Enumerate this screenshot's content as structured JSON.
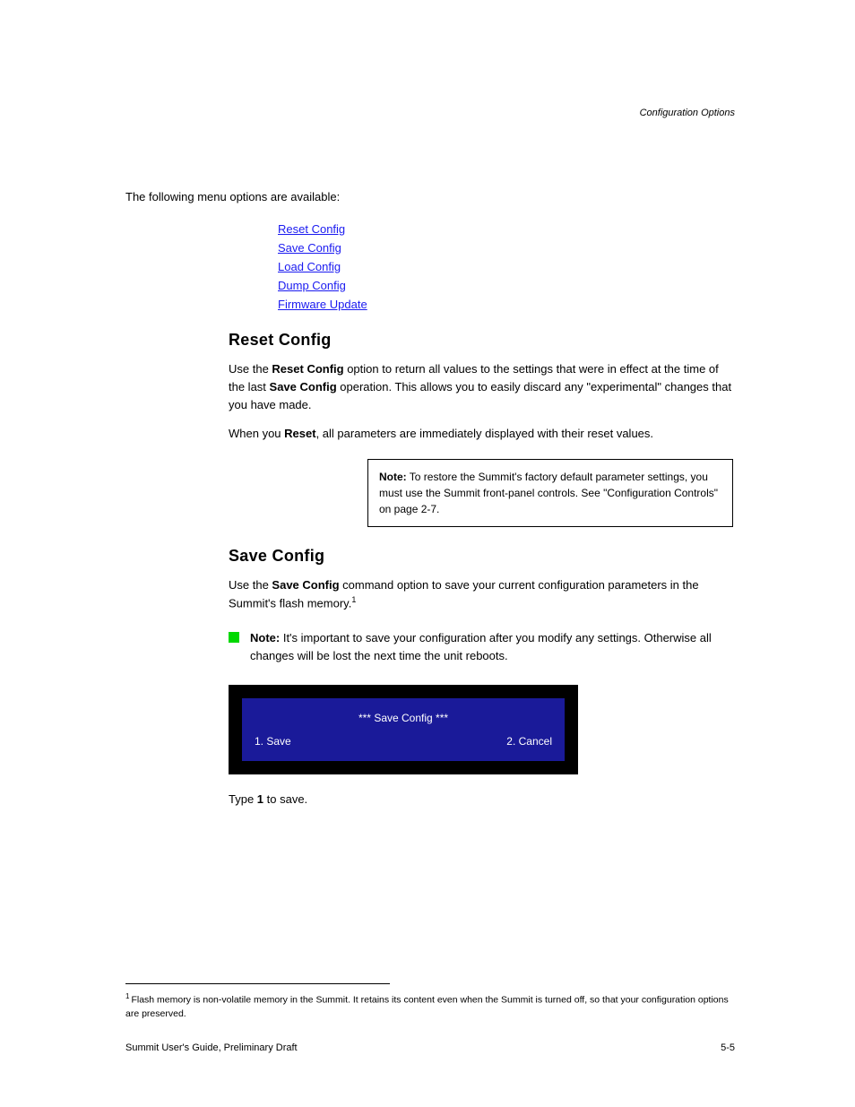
{
  "header_right": "Configuration Options",
  "intro": "The following menu options are available:",
  "links": [
    "Reset Config",
    "Save Config",
    "Load Config",
    "Dump Config",
    "Firmware Update"
  ],
  "reset": {
    "heading": "Reset Config",
    "para_before_bold": "Use the ",
    "bold1": "Reset Config",
    "para_mid": " option to return all values to the settings that were in effect at the time of the last ",
    "bold2": "Save Config",
    "para_after": " operation. This allows you to easily discard any \"experimental\" changes that you have made.",
    "para2_before": "When you ",
    "para2_bold": "Reset",
    "para2_after": ", all parameters are immediately displayed with their reset values.",
    "note_bold": "Note:",
    "note_text": " To restore the Summit's factory default parameter settings, you must use the Summit front-panel controls. See \"Configuration Controls\" on page 2-7."
  },
  "save": {
    "heading": "Save Config",
    "para_before": "Use the ",
    "para_bold": "Save Config",
    "para_after": " command option to save your current configuration parameters in the Summit's flash memory.",
    "note_label": "Note:",
    "note_body": " It's important to save your configuration after you modify any settings. Otherwise all changes will be lost the next time the unit reboots."
  },
  "keybox": {
    "line1": "*** Save Config ***",
    "line2a": "1. Save",
    "line2b": "2. Cancel"
  },
  "after_box_before": "Type ",
  "after_box_bold": "1",
  "after_box_after": " to save.",
  "footnote_num": "1",
  "footnote_text": "Flash memory is non-volatile memory in the Summit. It retains its content even when the Summit is turned off, so that your configuration options are preserved.",
  "footer_left": "Summit User's Guide, Preliminary Draft",
  "footer_right": "5-5"
}
